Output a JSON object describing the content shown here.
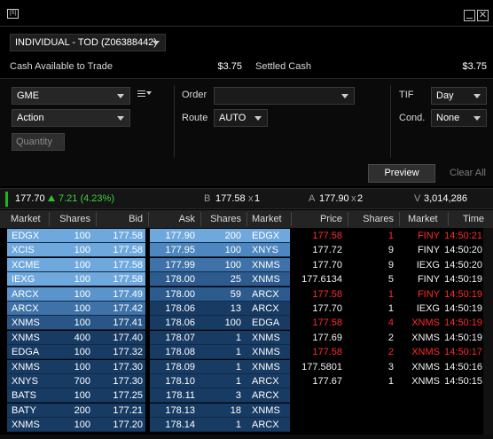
{
  "window": {
    "icon_text": "[S]",
    "close_glyph": "✕"
  },
  "account": {
    "label": "INDIVIDUAL - TOD (Z06388442)"
  },
  "balances": {
    "cash_label": "Cash Available to Trade",
    "cash_value": "$3.75",
    "settled_label": "Settled Cash",
    "settled_value": "$3.75"
  },
  "order_entry": {
    "symbol": "GME",
    "action": "Action",
    "quantity_placeholder": "Quantity",
    "order_label": "Order",
    "order_value": "",
    "route_label": "Route",
    "route_value": "AUTO",
    "tif_label": "TIF",
    "tif_value": "Day",
    "cond_label": "Cond.",
    "cond_value": "None",
    "preview_label": "Preview",
    "clear_label": "Clear All"
  },
  "quote": {
    "last": "177.70",
    "change": "7.21 (4.23%)",
    "bid_label": "B",
    "bid": "177.58",
    "bid_x": "x",
    "bid_size": "1",
    "ask_label": "A",
    "ask": "177.90",
    "ask_x": "x",
    "ask_size": "2",
    "vol_label": "V",
    "volume": "3,014,286"
  },
  "colors": {
    "bid_top": "#6fa8dc",
    "bid_mid": "#3d6fa3",
    "bid_low": "#14345a",
    "ask_top": "#6fa8dc",
    "trade_red": "#ff2a2a"
  },
  "bid_book": {
    "headers": [
      "Market",
      "Shares",
      "Bid"
    ],
    "rows": [
      {
        "market": "EDGX",
        "shares": "100",
        "price": "177.58",
        "tier": 0
      },
      {
        "market": "XCIS",
        "shares": "100",
        "price": "177.58",
        "tier": 0
      },
      {
        "market": "XCME",
        "shares": "100",
        "price": "177.58",
        "tier": 0
      },
      {
        "market": "IEXG",
        "shares": "100",
        "price": "177.58",
        "tier": 0
      },
      {
        "market": "ARCX",
        "shares": "100",
        "price": "177.49",
        "tier": 1
      },
      {
        "market": "ARCX",
        "shares": "100",
        "price": "177.42",
        "tier": 2
      },
      {
        "market": "XNMS",
        "shares": "100",
        "price": "177.41",
        "tier": 3
      },
      {
        "market": "XNMS",
        "shares": "400",
        "price": "177.40",
        "tier": 4
      },
      {
        "market": "EDGA",
        "shares": "100",
        "price": "177.32",
        "tier": 4
      },
      {
        "market": "XNMS",
        "shares": "100",
        "price": "177.30",
        "tier": 4
      },
      {
        "market": "XNYS",
        "shares": "700",
        "price": "177.30",
        "tier": 4
      },
      {
        "market": "BATS",
        "shares": "100",
        "price": "177.25",
        "tier": 4
      },
      {
        "market": "BATY",
        "shares": "200",
        "price": "177.21",
        "tier": 4
      },
      {
        "market": "XNMS",
        "shares": "100",
        "price": "177.20",
        "tier": 4
      }
    ]
  },
  "ask_book": {
    "headers": [
      "Ask",
      "Shares",
      "Market"
    ],
    "rows": [
      {
        "price": "177.90",
        "shares": "200",
        "market": "EDGX",
        "tier": 0
      },
      {
        "price": "177.95",
        "shares": "100",
        "market": "XNYS",
        "tier": 1
      },
      {
        "price": "177.99",
        "shares": "100",
        "market": "XNMS",
        "tier": 2
      },
      {
        "price": "178.00",
        "shares": "25",
        "market": "XNMS",
        "tier": 3
      },
      {
        "price": "178.00",
        "shares": "59",
        "market": "ARCX",
        "tier": 3
      },
      {
        "price": "178.06",
        "shares": "13",
        "market": "ARCX",
        "tier": 4
      },
      {
        "price": "178.06",
        "shares": "100",
        "market": "EDGA",
        "tier": 4
      },
      {
        "price": "178.07",
        "shares": "1",
        "market": "XNMS",
        "tier": 4
      },
      {
        "price": "178.08",
        "shares": "1",
        "market": "XNMS",
        "tier": 4
      },
      {
        "price": "178.09",
        "shares": "1",
        "market": "XNMS",
        "tier": 4
      },
      {
        "price": "178.10",
        "shares": "1",
        "market": "ARCX",
        "tier": 4
      },
      {
        "price": "178.11",
        "shares": "3",
        "market": "ARCX",
        "tier": 4
      },
      {
        "price": "178.13",
        "shares": "18",
        "market": "XNMS",
        "tier": 4
      },
      {
        "price": "178.14",
        "shares": "1",
        "market": "ARCX",
        "tier": 4
      }
    ]
  },
  "trades": {
    "headers": [
      "Price",
      "Shares",
      "Market",
      "Time"
    ],
    "rows": [
      {
        "price": "177.58",
        "shares": "1",
        "market": "FINY",
        "time": "14:50:21",
        "red": true
      },
      {
        "price": "177.72",
        "shares": "9",
        "market": "FINY",
        "time": "14:50:20",
        "red": false
      },
      {
        "price": "177.70",
        "shares": "9",
        "market": "IEXG",
        "time": "14:50:20",
        "red": false
      },
      {
        "price": "177.6134",
        "shares": "5",
        "market": "FINY",
        "time": "14:50:19",
        "red": false
      },
      {
        "price": "177.58",
        "shares": "1",
        "market": "FINY",
        "time": "14:50:19",
        "red": true
      },
      {
        "price": "177.70",
        "shares": "1",
        "market": "IEXG",
        "time": "14:50:19",
        "red": false
      },
      {
        "price": "177.58",
        "shares": "4",
        "market": "XNMS",
        "time": "14:50:19",
        "red": true
      },
      {
        "price": "177.69",
        "shares": "2",
        "market": "XNMS",
        "time": "14:50:19",
        "red": false
      },
      {
        "price": "177.58",
        "shares": "2",
        "market": "XNMS",
        "time": "14:50:17",
        "red": true
      },
      {
        "price": "177.5801",
        "shares": "3",
        "market": "XNMS",
        "time": "14:50:16",
        "red": false
      },
      {
        "price": "177.67",
        "shares": "1",
        "market": "XNMS",
        "time": "14:50:15",
        "red": false
      }
    ]
  }
}
